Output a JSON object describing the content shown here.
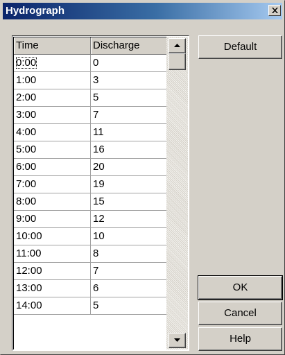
{
  "window": {
    "title": "Hydrograph"
  },
  "table": {
    "columns": [
      "Time",
      "Discharge"
    ],
    "rows": [
      [
        "0:00",
        "0"
      ],
      [
        "1:00",
        "3"
      ],
      [
        "2:00",
        "5"
      ],
      [
        "3:00",
        "7"
      ],
      [
        "4:00",
        "11"
      ],
      [
        "5:00",
        "16"
      ],
      [
        "6:00",
        "20"
      ],
      [
        "7:00",
        "19"
      ],
      [
        "8:00",
        "15"
      ],
      [
        "9:00",
        "12"
      ],
      [
        "10:00",
        "10"
      ],
      [
        "11:00",
        "8"
      ],
      [
        "12:00",
        "7"
      ],
      [
        "13:00",
        "6"
      ],
      [
        "14:00",
        "5"
      ]
    ],
    "selected_row": 0
  },
  "buttons": {
    "default": "Default",
    "ok": "OK",
    "cancel": "Cancel",
    "help": "Help"
  },
  "icons": {
    "close": "close-icon",
    "scroll_up": "arrow-up-icon",
    "scroll_down": "arrow-down-icon"
  }
}
